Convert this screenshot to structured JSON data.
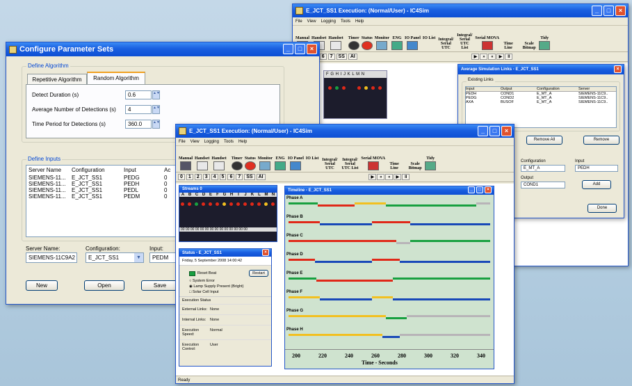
{
  "exec_back": {
    "title": "E_JCT_SS1 Execution: (Normal/User) - IC4Sim",
    "menu": [
      "File",
      "View",
      "Logging",
      "Tools",
      "Help"
    ],
    "tools": [
      "Manual",
      "Handset",
      "Handset",
      "Timer",
      "Status",
      "Monitor",
      "ENG",
      "IO Panel",
      "IO List",
      "Integral/ Serial UTC",
      "Integral/ Serial UTC List",
      "Serial MOVA",
      "Time Line",
      "Scale Bitmap",
      "Tidy"
    ],
    "stages": [
      "3",
      "4",
      "5",
      "6",
      "7",
      "SS",
      "AI"
    ],
    "nav": [
      "▶",
      "»",
      "«",
      "▶",
      "II"
    ],
    "streams_letters": "F G H I J K L M N"
  },
  "links_window": {
    "title": "Average Simulation Links - E_JCT_SS1",
    "existing_label": "Existing Links",
    "columns": [
      "Input",
      "Output",
      "Configuration",
      "Server"
    ],
    "rows": [
      [
        "PEDH",
        "COND1",
        "E_MT_A",
        "SIEMENS-11C9.."
      ],
      [
        "PEDG",
        "COND2",
        "E_MT_A",
        "SIEMENS-11C9.."
      ],
      [
        "AXA",
        "BUSOF",
        "E_MT_A",
        "SIEMENS-11C9.."
      ]
    ],
    "remove_all": "Remove All",
    "remove": "Remove",
    "configuration_label": "Configuration",
    "configuration_value": "E_MT_A",
    "input_label": "Input",
    "input_value": "PEDH",
    "output_label": "Output",
    "output_value": "COND1",
    "add": "Add",
    "done": "Done"
  },
  "config": {
    "title": "Configure Parameter Sets",
    "define_algorithm": "Define Algorithm",
    "tabs": [
      "Repetitive Algorithm",
      "Random Algorithm"
    ],
    "params": [
      {
        "label": "Detect Duration (s)",
        "value": "0.6"
      },
      {
        "label": "Average Number of Detections (s)",
        "value": "4"
      },
      {
        "label": "Time Period for Detections (s)",
        "value": "360.0"
      }
    ],
    "define_inputs": "Define Inputs",
    "columns": [
      "Server Name",
      "Configuration",
      "Input",
      "Ac"
    ],
    "rows": [
      [
        "SIEMENS-11...",
        "E_JCT_SS1",
        "PEDG",
        "0"
      ],
      [
        "SIEMENS-11...",
        "E_JCT_SS1",
        "PEDH",
        "0"
      ],
      [
        "SIEMENS-11...",
        "E_JCT_SS1",
        "PEDL",
        "0"
      ],
      [
        "SIEMENS-11...",
        "E_JCT_SS1",
        "PEDM",
        "0"
      ]
    ],
    "server_label": "Server Name:",
    "server_value": "SIEMENS-11C9A2",
    "configuration_label": "Configuration:",
    "configuration_value": "E_JCT_SS1",
    "input_label": "Input:",
    "input_value": "PEDM",
    "buttons": [
      "New",
      "Open",
      "Save"
    ]
  },
  "exec_front": {
    "title": "E_JCT_SS1 Execution: (Normal/User) - IC4Sim",
    "menu": [
      "File",
      "View",
      "Logging",
      "Tools",
      "Help"
    ],
    "tools": [
      "Manual",
      "Handset",
      "Handset",
      "Timer",
      "Status",
      "Monitor",
      "ENG",
      "IO Panel",
      "IO List",
      "Integral/ Serial UTC",
      "Integral/ Serial UTC List",
      "Serial MOVA",
      "Time Line",
      "Scale Bitmap",
      "Tidy"
    ],
    "stages": [
      "0",
      "1",
      "2",
      "3",
      "4",
      "5",
      "6",
      "7",
      "SS",
      "AI"
    ],
    "nav": [
      "▶",
      "»",
      "«",
      "▶",
      "II"
    ],
    "status_bar": "Ready"
  },
  "streams": {
    "title": "Streams 0",
    "letters": [
      "A",
      "B",
      "C",
      "D",
      "E",
      "F",
      "G",
      "H",
      "I",
      "J",
      "K",
      "L",
      "M",
      "N"
    ],
    "counts": "00 00 00 00 00 00 00 00 00 00 00 00 00 00"
  },
  "status_win": {
    "title": "Status - E_JCT_SS1",
    "date": "Friday, 5 September 2008 14:00:42",
    "reset_beat": "Reset Beat",
    "restart": "Restart",
    "system_error": "System Error",
    "lamp_supply": "Lamp Supply Present (Bright)",
    "solar_cell": "Solar Cell Input",
    "exec_status": "Execution Status",
    "rows": [
      {
        "label": "External Links:",
        "value": "None"
      },
      {
        "label": "Internal Links:",
        "value": "None"
      },
      {
        "label": "Execution Speed:",
        "value": "Normal"
      },
      {
        "label": "Execution Control:",
        "value": "User"
      }
    ]
  },
  "timeline": {
    "title": "Timeline - E_JCT_SS1",
    "phases": [
      "Phase A",
      "Phase B",
      "Phase C",
      "Phase D",
      "Phase E",
      "Phase F",
      "Phase G",
      "Phase H"
    ],
    "ticks": [
      "200",
      "220",
      "240",
      "260",
      "280",
      "300",
      "320",
      "340"
    ],
    "xlabel": "Time - Seconds",
    "colors": {
      "red": "#e02818",
      "amber": "#f2c020",
      "green": "#18a040",
      "blue": "#1848b8",
      "grey": "#b8b4b8",
      "bg": "#cfe3cf"
    }
  }
}
